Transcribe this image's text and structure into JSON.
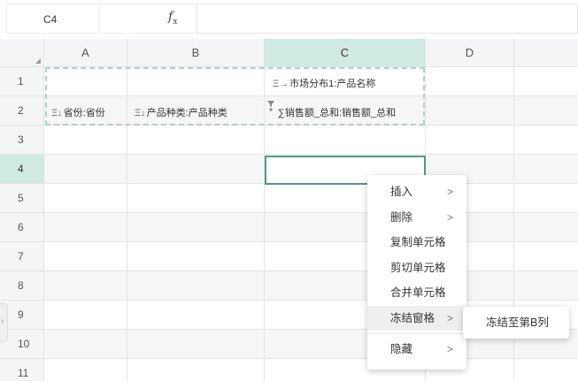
{
  "formula_bar": {
    "cell_ref": "C4",
    "fx_symbol": "f",
    "fx_sub": "x",
    "formula_value": ""
  },
  "columns": [
    "A",
    "B",
    "C",
    "D"
  ],
  "rows": [
    "1",
    "2",
    "3",
    "4",
    "5",
    "6",
    "7",
    "8",
    "9",
    "10",
    "11"
  ],
  "selected_column": "C",
  "selected_row": "4",
  "cells": {
    "c1_icon": "Ξ→",
    "c1_text": "市场分布1:产品名称",
    "a2_icon": "Ξ↓",
    "a2_text": "省份:省份",
    "b2_icon": "Ξ↓",
    "b2_text": "产品种类:产品种类",
    "c2_text": "∑销售额_总和:销售额_总和"
  },
  "context_menu": {
    "items": [
      {
        "label": "插入",
        "arrow": ">"
      },
      {
        "label": "删除",
        "arrow": ">"
      },
      {
        "label": "复制单元格",
        "arrow": ""
      },
      {
        "label": "剪切单元格",
        "arrow": ""
      },
      {
        "label": "合并单元格",
        "arrow": ""
      },
      {
        "label": "冻结窗格",
        "arrow": ">"
      },
      {
        "label": "隐藏",
        "arrow": ">"
      }
    ],
    "active_item": "冻结窗格"
  },
  "submenu": {
    "label": "冻结至第B列"
  },
  "edge_tab": {
    "glyph": "›"
  },
  "colors": {
    "selection_border": "#4d9a8a",
    "header_selected": "#cfe9e3",
    "dashed_range": "#a9d3cc"
  }
}
